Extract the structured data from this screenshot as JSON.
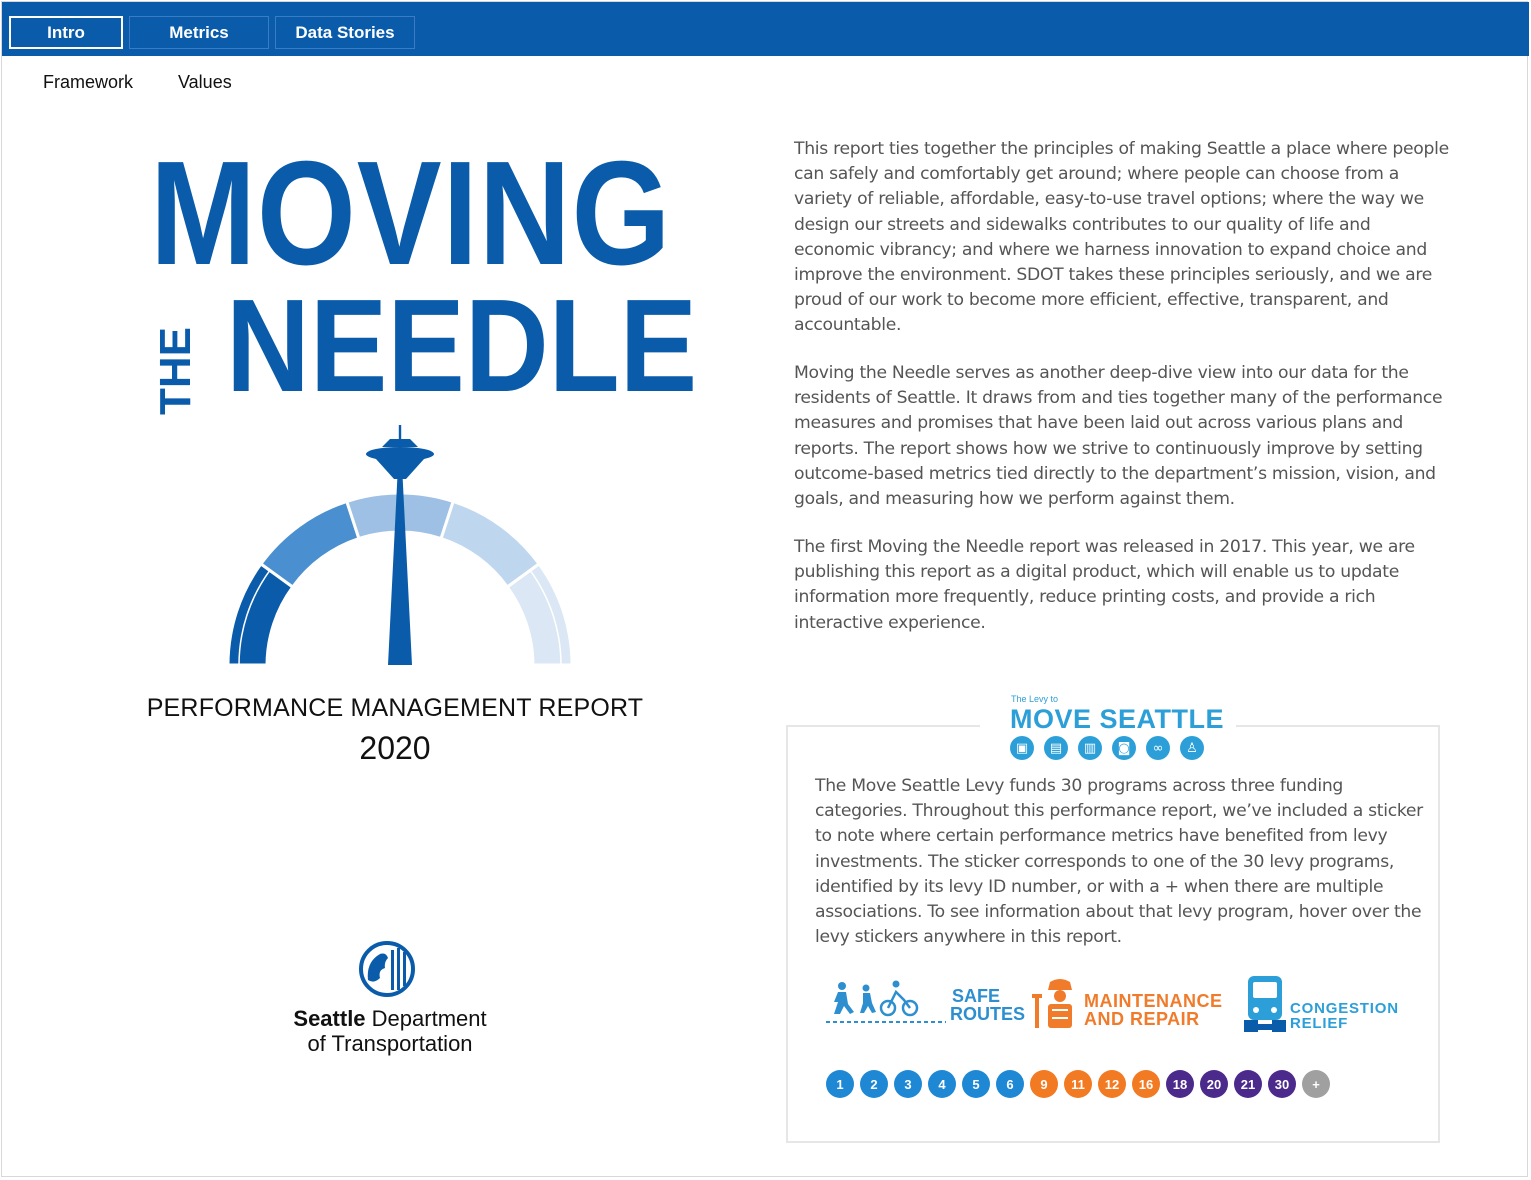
{
  "tabs": [
    {
      "label": "Intro",
      "active": true
    },
    {
      "label": "Metrics",
      "active": false
    },
    {
      "label": "Data Stories",
      "active": false
    }
  ],
  "subnav": [
    "Framework",
    "Values"
  ],
  "cover": {
    "title_line1": "MOVING",
    "title_the": "THE",
    "title_line2": "NEEDLE",
    "report_title": "PERFORMANCE MANAGEMENT REPORT",
    "report_year": "2020",
    "sdot_line1_bold": "Seattle",
    "sdot_line1_rest": " Department",
    "sdot_line2": "of Transportation"
  },
  "intro_paragraphs": [
    "This report ties together the principles of making Seattle a place where people can safely and comfortably get around; where people can choose from a variety of reliable, affordable, easy-to-use travel options; where the way we design our streets and sidewalks contributes to our quality of life and economic vibrancy; and where we harness innovation to expand choice and improve the environment. SDOT takes these principles seriously, and we are proud of our work to become more efficient, effective, transparent, and accountable.",
    "Moving the Needle serves as another deep-dive view into our data for the residents of Seattle. It draws from and ties together many of the performance measures and promises that have been laid out across various plans and reports. The report shows how we strive to continuously improve by setting outcome-based metrics tied directly to the department’s mission, vision, and goals, and measuring how we perform against them.",
    "The first Moving the Needle report was released in 2017. This year, we are publishing this report as a digital product, which will enable us to update information more frequently, reduce printing costs, and provide a rich interactive experience."
  ],
  "levy": {
    "logo_small": "The Levy to",
    "logo_name": "MOVE SEATTLE",
    "text": "The Move Seattle Levy funds 30 programs across three funding categories. Throughout this performance report, we’ve included a sticker to note where certain performance metrics have benefited from levy investments. The sticker corresponds to one of the 30 levy programs, identified by its levy ID number, or with a + when there are multiple associations. To see information about that levy program, hover over the levy stickers anywhere in this report.",
    "categories": {
      "safe_1": "SAFE",
      "safe_2": "ROUTES",
      "maint_1": "MAINTENANCE",
      "maint_2": "AND REPAIR",
      "cong_1": "CONGESTION",
      "cong_2": "RELIEF"
    },
    "stickers": [
      {
        "label": "1",
        "color": "#1e88d4"
      },
      {
        "label": "2",
        "color": "#1e88d4"
      },
      {
        "label": "3",
        "color": "#1e88d4"
      },
      {
        "label": "4",
        "color": "#1e88d4"
      },
      {
        "label": "5",
        "color": "#1e88d4"
      },
      {
        "label": "6",
        "color": "#1e88d4"
      },
      {
        "label": "9",
        "color": "#f27a22"
      },
      {
        "label": "11",
        "color": "#f27a22"
      },
      {
        "label": "12",
        "color": "#f27a22"
      },
      {
        "label": "16",
        "color": "#f27a22"
      },
      {
        "label": "18",
        "color": "#4b2a8c"
      },
      {
        "label": "20",
        "color": "#4b2a8c"
      },
      {
        "label": "21",
        "color": "#4b2a8c"
      },
      {
        "label": "30",
        "color": "#4b2a8c"
      },
      {
        "label": "+",
        "color": "#a0a0a0"
      }
    ]
  },
  "colors": {
    "brand_blue": "#0a5cab",
    "levy_blue": "#2d9fd8",
    "orange": "#f07b2b"
  }
}
